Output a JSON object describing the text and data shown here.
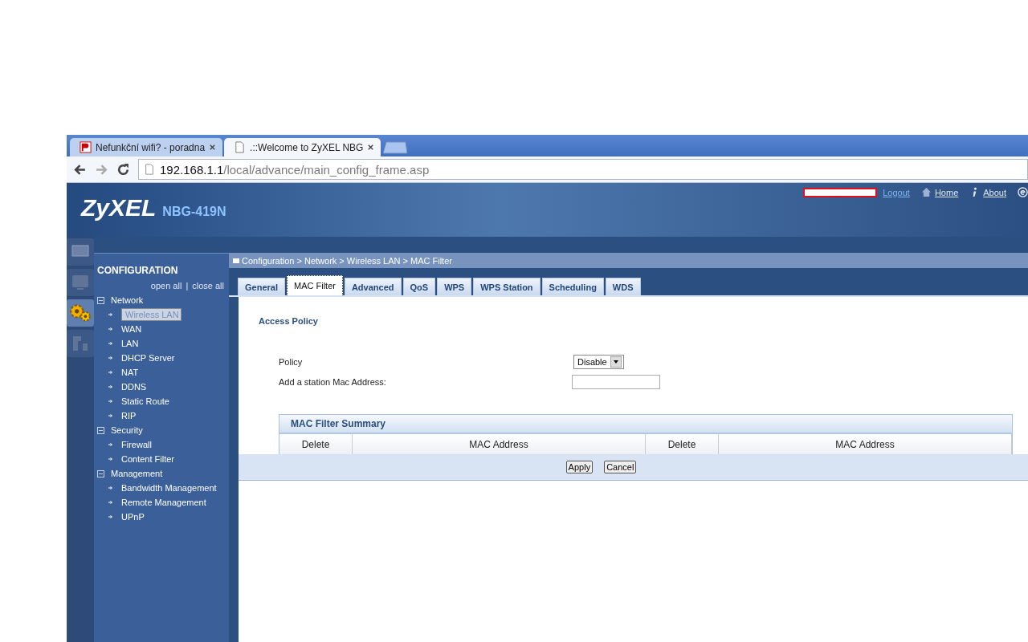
{
  "browser": {
    "tabs": [
      {
        "title": "Nefunkční wifi? - poradna",
        "selected": false,
        "kind": "site"
      },
      {
        "title": ".::Welcome to ZyXEL NBG",
        "selected": true,
        "kind": "page"
      }
    ],
    "address": {
      "host": "192.168.1.1",
      "path": "/local/advance/main_config_frame.asp"
    }
  },
  "header": {
    "logo": "ZyXEL",
    "model": "NBG-419N",
    "links": [
      {
        "label": "Logout",
        "kind": "text"
      },
      {
        "label": "Home",
        "kind": "home"
      },
      {
        "label": "About",
        "kind": "info"
      }
    ]
  },
  "rail": [
    {
      "kind": "monitor",
      "selected": false
    },
    {
      "kind": "screen",
      "selected": false
    },
    {
      "kind": "gears",
      "selected": true
    },
    {
      "kind": "tool",
      "selected": false
    }
  ],
  "sidebar": {
    "title": "CONFIGURATION",
    "open_all": "open all",
    "separator": "|",
    "close_all": "close all",
    "tree": [
      {
        "label": "Network",
        "expanded": true,
        "children": [
          {
            "label": "Wireless LAN",
            "selected": true
          },
          {
            "label": "WAN",
            "selected": false
          },
          {
            "label": "LAN",
            "selected": false
          },
          {
            "label": "DHCP Server",
            "selected": false
          },
          {
            "label": "NAT",
            "selected": false
          },
          {
            "label": "DDNS",
            "selected": false
          },
          {
            "label": "Static Route",
            "selected": false
          },
          {
            "label": "RIP",
            "selected": false
          }
        ]
      },
      {
        "label": "Security",
        "expanded": true,
        "children": [
          {
            "label": "Firewall",
            "selected": false
          },
          {
            "label": "Content Filter",
            "selected": false
          }
        ]
      },
      {
        "label": "Management",
        "expanded": true,
        "children": [
          {
            "label": "Bandwidth Management",
            "selected": false
          },
          {
            "label": "Remote Management",
            "selected": false
          },
          {
            "label": "UPnP",
            "selected": false
          }
        ]
      }
    ]
  },
  "breadcrumb": "Configuration > Network > Wireless LAN > MAC Filter",
  "tabs": [
    {
      "label": "General",
      "selected": false
    },
    {
      "label": "MAC Filter",
      "selected": true
    },
    {
      "label": "Advanced",
      "selected": false
    },
    {
      "label": "QoS",
      "selected": false
    },
    {
      "label": "WPS",
      "selected": false
    },
    {
      "label": "WPS Station",
      "selected": false
    },
    {
      "label": "Scheduling",
      "selected": false
    },
    {
      "label": "WDS",
      "selected": false
    }
  ],
  "section_title": "Access Policy",
  "policy": {
    "label": "Policy",
    "value": "Disable"
  },
  "station": {
    "label": "Add a station Mac Address:"
  },
  "summary": {
    "title": "MAC Filter Summary",
    "columns": [
      "Delete",
      "MAC Address",
      "Delete",
      "MAC Address"
    ]
  },
  "buttons": [
    "Apply",
    "Cancel"
  ]
}
